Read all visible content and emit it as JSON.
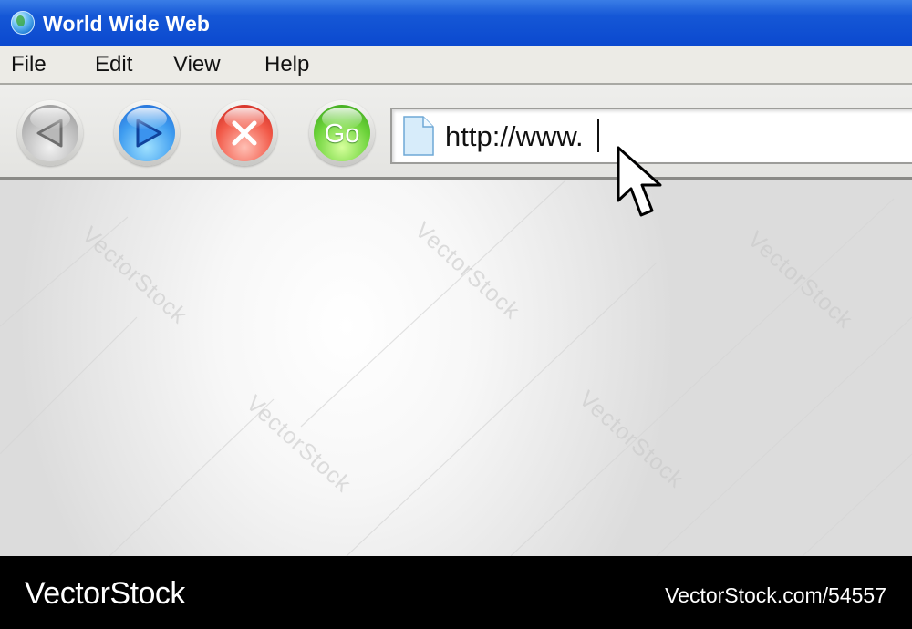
{
  "window": {
    "title": "World Wide Web",
    "icon": "globe-icon"
  },
  "menu": {
    "items": [
      "File",
      "Edit",
      "View",
      "Help"
    ]
  },
  "toolbar": {
    "back_icon": "back-arrow-icon",
    "forward_icon": "forward-arrow-icon",
    "stop_icon": "stop-x-icon",
    "go_label": "Go",
    "colors": {
      "back": "#9e9e9e",
      "forward": "#2f84e8",
      "stop": "#e63b2e",
      "go": "#55c22a"
    }
  },
  "address": {
    "value": "http://www.",
    "icon": "page-icon"
  },
  "content": {
    "watermark": "VectorStock"
  },
  "footer": {
    "brand": "VectorStock",
    "id": "VectorStock.com/54557"
  },
  "colors": {
    "titlebar": "#1557d6",
    "menubar": "#ecebe6",
    "footer": "#000000"
  }
}
